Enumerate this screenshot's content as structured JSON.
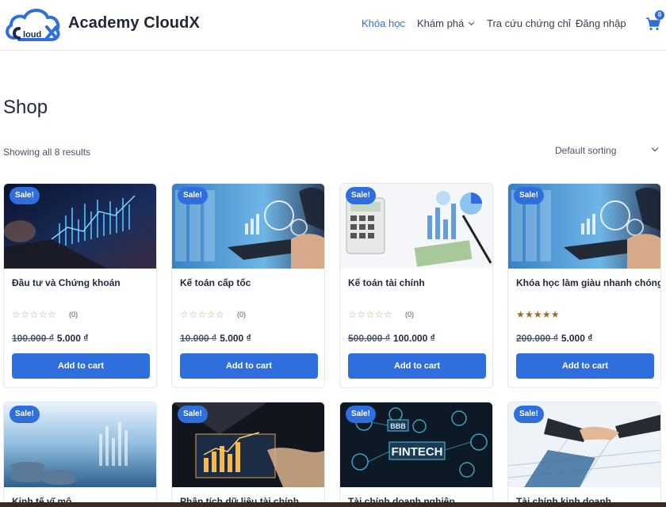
{
  "header": {
    "logo_text": "loud",
    "site_title": "Academy CloudX",
    "nav": [
      {
        "label": "Khóa học",
        "active": true
      },
      {
        "label": "Khám phá",
        "has_dropdown": true
      },
      {
        "label": "Tra cứu chứng chỉ"
      },
      {
        "label": "Đăng nhập"
      }
    ],
    "cart_count": "0"
  },
  "shop": {
    "title": "Shop",
    "result_count": "Showing all 8 results",
    "sorting": "Default sorting"
  },
  "products": [
    {
      "name": "Đầu tư và Chứng khoán",
      "badge": "Sale!",
      "rating_count": "(0)",
      "rating": 0,
      "old_price": "100.000 ₫",
      "price": "5.000 ₫",
      "button": "Add to cart"
    },
    {
      "name": "Kế toán cấp tốc",
      "badge": "Sale!",
      "rating_count": "(0)",
      "rating": 0,
      "old_price": "10.000 ₫",
      "price": "5.000 ₫",
      "button": "Add to cart"
    },
    {
      "name": "Kế toán tài chính",
      "badge": "Sale!",
      "rating_count": "(0)",
      "rating": 0,
      "old_price": "500.000 ₫",
      "price": "100.000 ₫",
      "button": "Add to cart"
    },
    {
      "name": "Khóa học làm giàu nhanh chóng",
      "badge": "Sale!",
      "rating_count": "",
      "rating": 5,
      "old_price": "200.000 ₫",
      "price": "5.000 ₫",
      "button": "Add to cart"
    },
    {
      "name": "Kinh tế vĩ mô",
      "badge": "Sale!"
    },
    {
      "name": "Phân tích dữ liệu tài chính",
      "badge": "Sale!"
    },
    {
      "name": "Tài chính doanh nghiệp",
      "badge": "Sale!",
      "image_text": "FINTECH"
    },
    {
      "name": "Tài chính kinh doanh",
      "badge": "Sale!"
    }
  ],
  "icons": {
    "cart": "shopping-cart-icon",
    "logo": "cloud-logo-icon",
    "dropdown": "chevron-down-icon",
    "star_empty": "☆☆☆☆☆",
    "star_full": "★★★★★"
  },
  "colors": {
    "accent": "#2f6fdd",
    "star_full": "#9b6a24",
    "star_empty": "#c9a86a"
  }
}
